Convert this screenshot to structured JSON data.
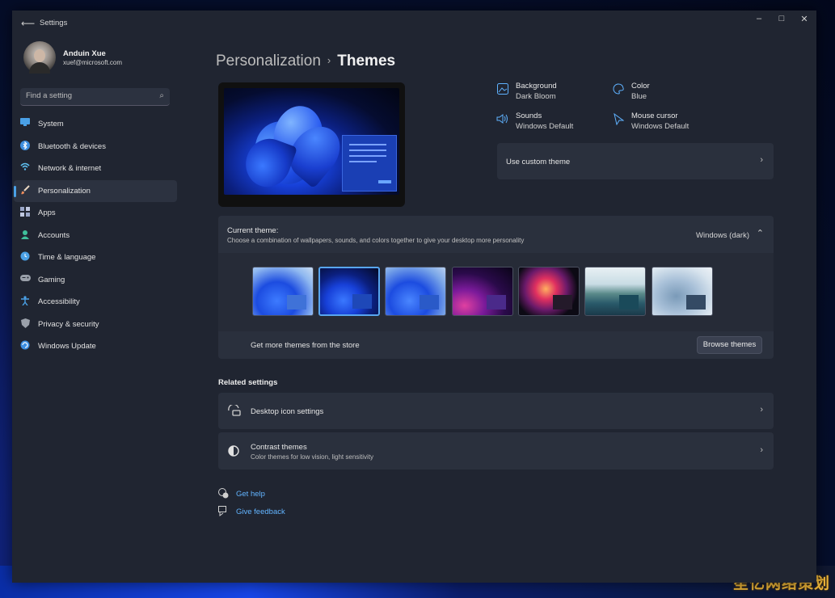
{
  "window": {
    "title": "Settings",
    "minimize": "–",
    "maximize": "□",
    "close": "✕"
  },
  "user": {
    "name": "Anduin Xue",
    "email": "xuef@microsoft.com"
  },
  "search": {
    "placeholder": "Find a setting"
  },
  "sidebar": {
    "items": [
      {
        "label": "System",
        "icon": "monitor-icon",
        "color": "#4aa0e6"
      },
      {
        "label": "Bluetooth & devices",
        "icon": "bluetooth-icon",
        "color": "#3d8ee0"
      },
      {
        "label": "Network & internet",
        "icon": "wifi-icon",
        "color": "#5fc0f0"
      },
      {
        "label": "Personalization",
        "icon": "brush-icon",
        "color": "#e88a5a"
      },
      {
        "label": "Apps",
        "icon": "apps-icon",
        "color": "#9aa6c8"
      },
      {
        "label": "Accounts",
        "icon": "person-icon",
        "color": "#3fbf9a"
      },
      {
        "label": "Time & language",
        "icon": "globe-clock-icon",
        "color": "#4aa0e6"
      },
      {
        "label": "Gaming",
        "icon": "gamepad-icon",
        "color": "#9aa0aa"
      },
      {
        "label": "Accessibility",
        "icon": "accessibility-icon",
        "color": "#4aa0e6"
      },
      {
        "label": "Privacy & security",
        "icon": "shield-icon",
        "color": "#9aa0aa"
      },
      {
        "label": "Windows Update",
        "icon": "update-icon",
        "color": "#3d8ee0"
      }
    ],
    "active_index": 3
  },
  "breadcrumb": {
    "parent": "Personalization",
    "separator": "›",
    "current": "Themes"
  },
  "properties": {
    "background": {
      "title": "Background",
      "value": "Dark Bloom"
    },
    "color": {
      "title": "Color",
      "value": "Blue"
    },
    "sounds": {
      "title": "Sounds",
      "value": "Windows Default"
    },
    "cursor": {
      "title": "Mouse cursor",
      "value": "Windows Default"
    }
  },
  "custom_theme": {
    "label": "Use custom theme"
  },
  "current_theme": {
    "title": "Current theme:",
    "description": "Choose a combination of wallpapers, sounds, and colors together to give your desktop more personality",
    "value": "Windows (dark)",
    "selected_index": 1,
    "themes": [
      {
        "name": "windows-light",
        "accent": "#2f6bd8"
      },
      {
        "name": "windows-dark",
        "accent": "#2050c0"
      },
      {
        "name": "glow",
        "accent": "#2f6bd8"
      },
      {
        "name": "captured-motion",
        "accent": "#5a2a9a"
      },
      {
        "name": "flow",
        "accent": "#c01838"
      },
      {
        "name": "sunrise",
        "accent": "#2a6a80"
      },
      {
        "name": "glow-light",
        "accent": "#3a4a60"
      }
    ]
  },
  "store": {
    "label": "Get more themes from the store",
    "button": "Browse themes"
  },
  "related": {
    "title": "Related settings",
    "desktop_icons": {
      "label": "Desktop icon settings"
    },
    "contrast": {
      "label": "Contrast themes",
      "sub": "Color themes for low vision, light sensitivity"
    }
  },
  "help": {
    "get_help": "Get help",
    "feedback": "Give feedback"
  },
  "watermark": "笙亿网络策划",
  "colors": {
    "accent": "#4aa0e6",
    "link": "#62b4ff",
    "window_bg": "#202531",
    "card_bg": "#2a303d"
  }
}
